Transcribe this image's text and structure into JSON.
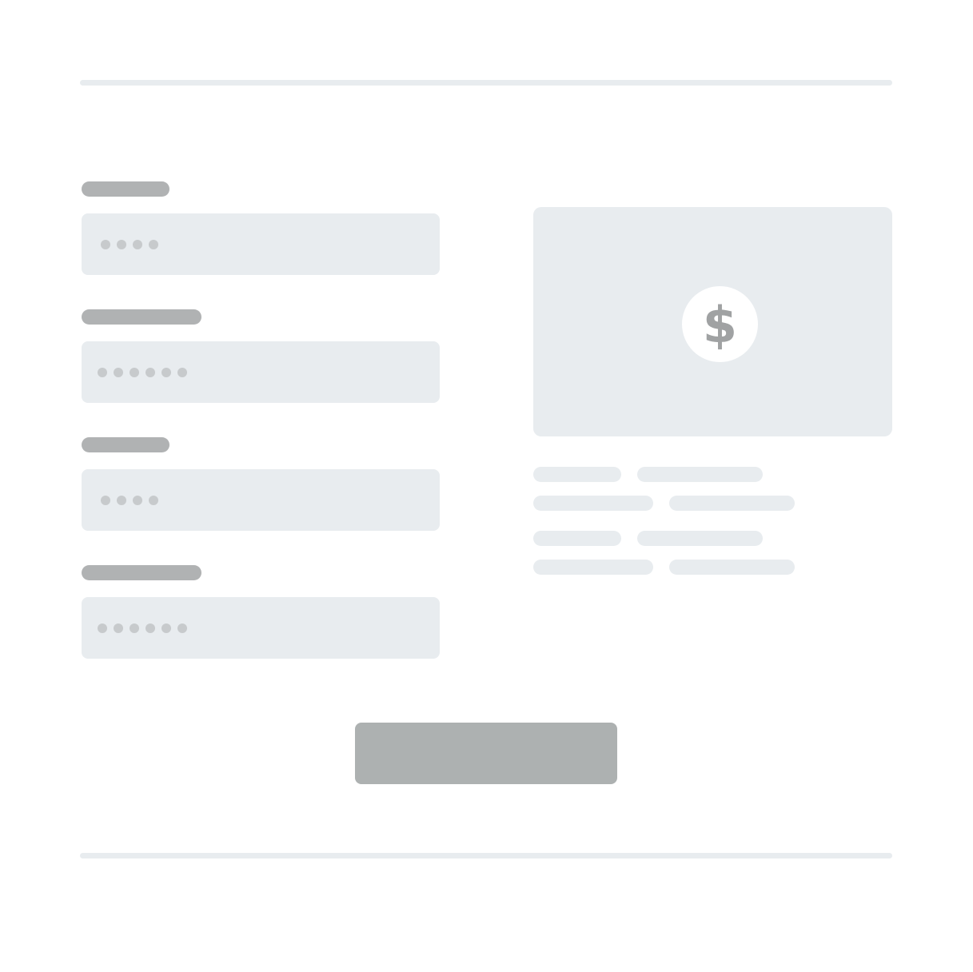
{
  "colors": {
    "divider": "#e8ecef",
    "label_bar": "#b0b2b3",
    "input_background": "#e8ecef",
    "input_dot": "#c7cacc",
    "card_background": "#e8ecef",
    "coin_glyph": "#a0a2a3",
    "detail_pill": "#e8ecef",
    "button": "#adb1b1"
  },
  "form": {
    "fields": [
      {
        "name": "field-1",
        "masked_length": 4
      },
      {
        "name": "field-2",
        "masked_length": 6
      },
      {
        "name": "field-3",
        "masked_length": 4
      },
      {
        "name": "field-4",
        "masked_length": 6
      }
    ],
    "submit_label": ""
  },
  "summary_card": {
    "icon": "dollar-icon",
    "glyph": "$"
  }
}
